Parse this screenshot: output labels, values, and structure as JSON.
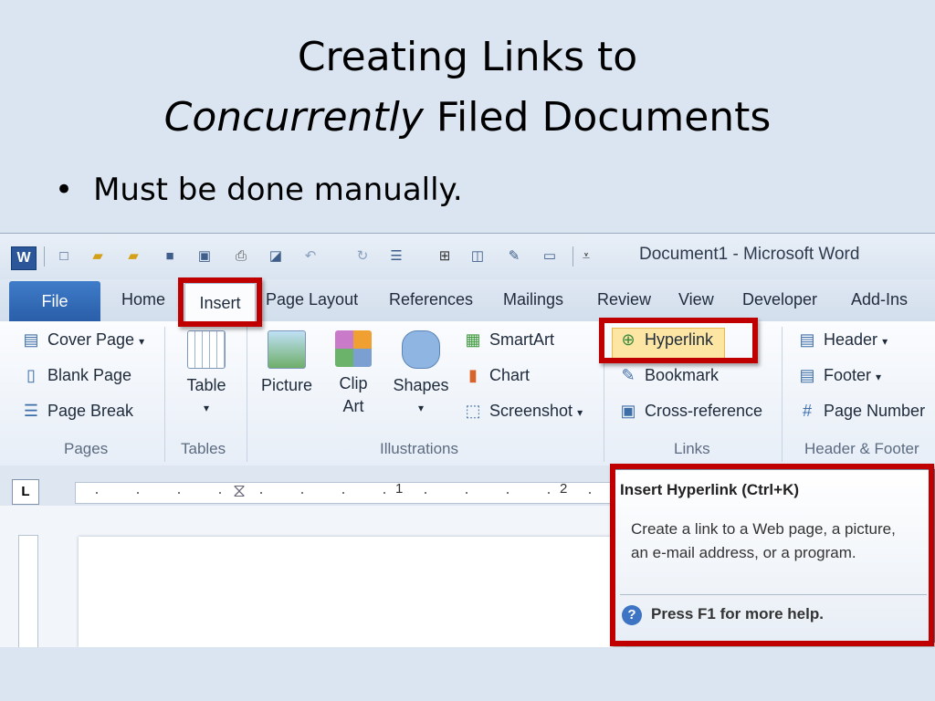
{
  "slide": {
    "title_line1": "Creating Links to",
    "title_line2_italic": "Concurrently",
    "title_line2_rest": " Filed Documents",
    "bullet_symbol": "•",
    "bullet_text": "Must be done manually."
  },
  "window": {
    "logo_letter": "W",
    "title": "Document1  -  Microsoft Word"
  },
  "quick_access_icons": [
    "new-document-icon",
    "open-folder-icon",
    "open-folder-icon",
    "save-icon",
    "save-as-icon",
    "print-icon",
    "print-preview-icon",
    "undo-icon",
    "redo-icon",
    "numbering-icon",
    "org-chart-icon",
    "insert-object-icon",
    "spelling-icon",
    "text-box-icon",
    "customize-quick-access-icon"
  ],
  "tabs": {
    "file": "File",
    "home": "Home",
    "insert": "Insert",
    "page_layout": "Page Layout",
    "references": "References",
    "mailings": "Mailings",
    "review": "Review",
    "view": "View",
    "developer": "Developer",
    "addins": "Add-Ins"
  },
  "ribbon": {
    "pages": {
      "label": "Pages",
      "items": [
        "Cover Page",
        "Blank Page",
        "Page Break"
      ]
    },
    "tables": {
      "label": "Tables",
      "table": "Table"
    },
    "illustrations": {
      "label": "Illustrations",
      "picture": "Picture",
      "clip_art_1": "Clip",
      "clip_art_2": "Art",
      "shapes": "Shapes",
      "smartart": "SmartArt",
      "chart": "Chart",
      "screenshot": "Screenshot"
    },
    "links": {
      "label": "Links",
      "hyperlink": "Hyperlink",
      "bookmark": "Bookmark",
      "cross_reference": "Cross-reference"
    },
    "header_footer": {
      "label": "Header & Footer",
      "header": "Header",
      "footer": "Footer",
      "page_number": "Page Number"
    }
  },
  "ruler": {
    "corner": "L",
    "numbers": [
      "1",
      "2"
    ]
  },
  "tooltip": {
    "title": "Insert Hyperlink (Ctrl+K)",
    "body": "Create a link to a Web page, a picture, an e-mail address, or a program.",
    "help": "Press F1 for more help."
  },
  "colors": {
    "slide_background": "#dbe5f1",
    "highlight_red": "#c00000",
    "file_tab_blue": "#2b5fa8",
    "hyperlink_hover": "#fde6a3"
  }
}
